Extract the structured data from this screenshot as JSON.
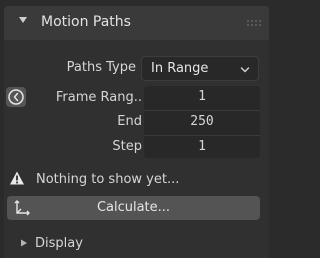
{
  "panel": {
    "title": "Motion Paths",
    "expanded": true
  },
  "paths_type": {
    "label": "Paths Type",
    "value": "In Range"
  },
  "frame_range": {
    "label": "Frame Rang..",
    "start": "1",
    "end_label": "End",
    "end": "250",
    "step_label": "Step",
    "step": "1"
  },
  "warning": {
    "text": "Nothing to show yet..."
  },
  "calculate": {
    "label": "Calculate..."
  },
  "display": {
    "title": "Display",
    "expanded": false
  },
  "colors": {
    "background": "#2b2b2b",
    "header": "#3a3a3a",
    "field": "#282828",
    "button": "#545454",
    "text": "#d6d6d6"
  },
  "icons": {
    "header_arrow": "triangle-down-icon",
    "grip": "drag-grip-icon",
    "dropdown": "chevron-down-icon",
    "clock": "clock-icon",
    "warning": "warning-icon",
    "calculate": "axis-transform-icon",
    "display_arrow": "triangle-right-icon"
  }
}
